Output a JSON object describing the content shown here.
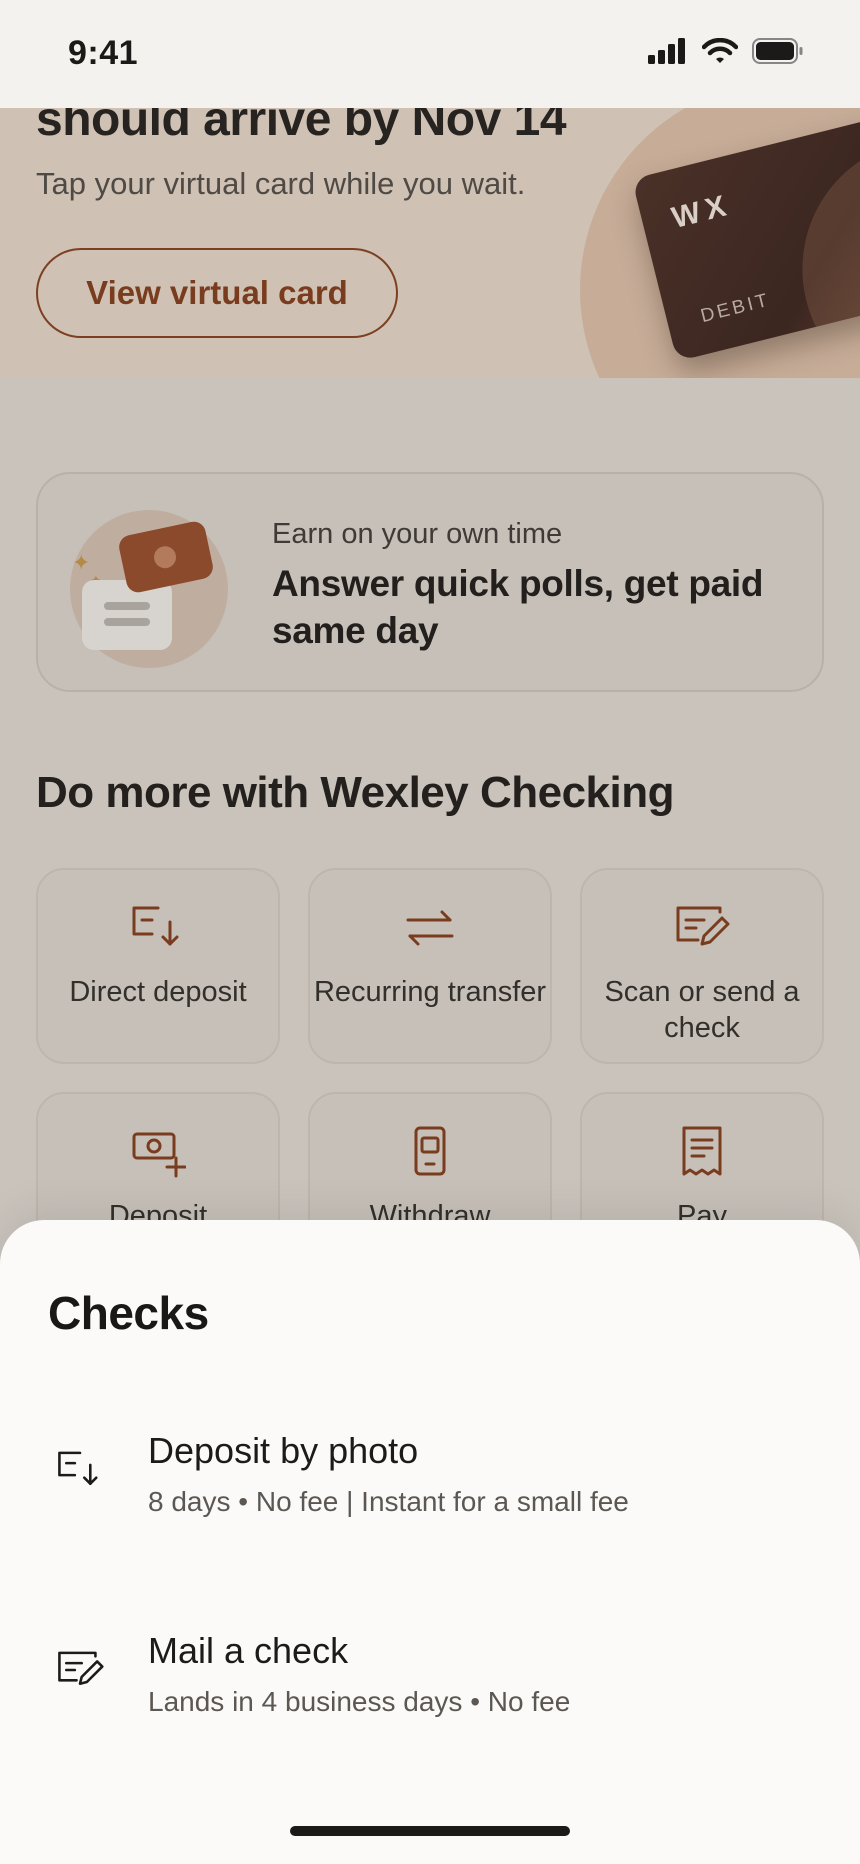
{
  "status_bar": {
    "time": "9:41"
  },
  "hero": {
    "headline": "should arrive by Nov 14",
    "subtitle": "Tap your virtual card while you wait.",
    "button_label": "View virtual card",
    "card_logo": "WX",
    "card_type": "DEBIT"
  },
  "earn_card": {
    "kicker": "Earn on your own time",
    "title": "Answer quick polls, get paid same day"
  },
  "section": {
    "title": "Do more with Wexley Checking",
    "tiles": [
      {
        "label": "Direct deposit",
        "icon": "direct-deposit-icon"
      },
      {
        "label": "Recurring transfer",
        "icon": "transfer-arrows-icon"
      },
      {
        "label": "Scan or send a check",
        "icon": "check-edit-icon"
      },
      {
        "label": "Deposit",
        "icon": "cash-deposit-icon"
      },
      {
        "label": "Withdraw",
        "icon": "phone-withdraw-icon"
      },
      {
        "label": "Pay",
        "icon": "receipt-icon"
      }
    ]
  },
  "sheet": {
    "title": "Checks",
    "options": [
      {
        "title": "Deposit by photo",
        "subtitle": "8 days • No fee | Instant for a small fee",
        "icon": "direct-deposit-icon"
      },
      {
        "title": "Mail a check",
        "subtitle": "Lands in 4 business days • No fee",
        "icon": "check-edit-icon"
      }
    ]
  },
  "colors": {
    "accent": "#7a3c1e",
    "sheet_bg": "#fbfaf8",
    "scrim_bg": "#c9c3bc"
  }
}
